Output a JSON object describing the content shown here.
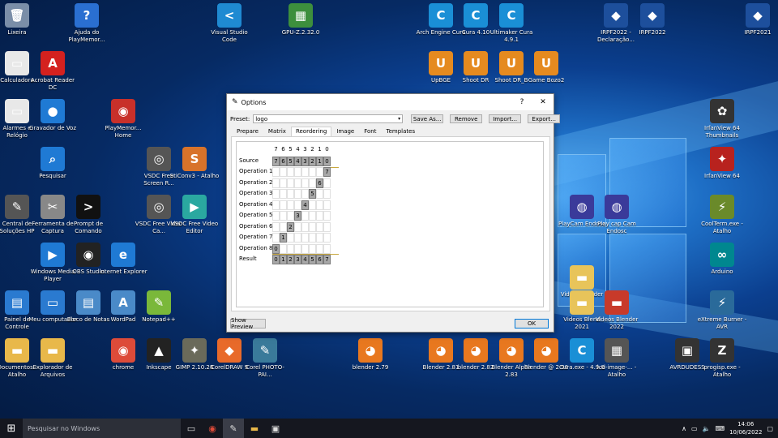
{
  "desktop_icons": [
    {
      "id": "lixeira",
      "label": "Lixeira",
      "color": "#7a8ea8",
      "glyph": "🗑"
    },
    {
      "id": "ajuda",
      "label": "Ajuda do PlayMemor...",
      "color": "#2a6fd1",
      "glyph": "?"
    },
    {
      "id": "vscode",
      "label": "Visual Studio Code",
      "color": "#1f8ad2",
      "glyph": "<"
    },
    {
      "id": "gpuz",
      "label": "GPU-Z.2.32.0",
      "color": "#3d8f3d",
      "glyph": "▦"
    },
    {
      "id": "arch",
      "label": "Arch Engine Cura",
      "color": "#1a8fd6",
      "glyph": "C"
    },
    {
      "id": "cura410",
      "label": "Cura 4.10",
      "color": "#1a8fd6",
      "glyph": "C"
    },
    {
      "id": "ultimaker",
      "label": "Ultimaker Cura 4.9.1",
      "color": "#1a8fd6",
      "glyph": "C"
    },
    {
      "id": "irpf2022d",
      "label": "IRPF2022 - Declaração...",
      "color": "#1d4f9c",
      "glyph": "◆"
    },
    {
      "id": "irpf2022",
      "label": "IRPF2022",
      "color": "#1d4f9c",
      "glyph": "◆"
    },
    {
      "id": "irpf2021",
      "label": "IRPF2021",
      "color": "#1d4f9c",
      "glyph": "◆"
    },
    {
      "id": "calculadora",
      "label": "Calculadora",
      "color": "#e8e8e8",
      "glyph": "▭"
    },
    {
      "id": "acrobat",
      "label": "Acrobat Reader DC",
      "color": "#d4211f",
      "glyph": "A"
    },
    {
      "id": "upbge",
      "label": "UpBGE",
      "color": "#e58a1f",
      "glyph": "U"
    },
    {
      "id": "shootdr",
      "label": "Shoot DR",
      "color": "#e58a1f",
      "glyph": "U"
    },
    {
      "id": "shootdrb",
      "label": "Shoot DR_B",
      "color": "#e58a1f",
      "glyph": "U"
    },
    {
      "id": "gamebozo",
      "label": "Game Bozo2",
      "color": "#e58a1f",
      "glyph": "U"
    },
    {
      "id": "alarmes",
      "label": "Alarmes e Relógio",
      "color": "#e8e8e8",
      "glyph": "▭"
    },
    {
      "id": "gravador",
      "label": "Gravador de Voz",
      "color": "#1f7ad4",
      "glyph": "●"
    },
    {
      "id": "playhome",
      "label": "PlayMemor... Home",
      "color": "#c8302a",
      "glyph": "◉"
    },
    {
      "id": "irfanthumb",
      "label": "IrfanView 64 Thumbnails",
      "color": "#333",
      "glyph": "✿"
    },
    {
      "id": "pesquisar",
      "label": "Pesquisar",
      "color": "#1f7ad4",
      "glyph": "⌕"
    },
    {
      "id": "vsdcscreen",
      "label": "VSDC Free Screen R...",
      "color": "#555",
      "glyph": "◎"
    },
    {
      "id": "stconv",
      "label": "StiConv3 - Atalho",
      "color": "#d8732a",
      "glyph": "S"
    },
    {
      "id": "irfan64",
      "label": "IrfanView 64",
      "color": "#b8221e",
      "glyph": "✦"
    },
    {
      "id": "hp",
      "label": "Central de Soluções HP",
      "color": "#555",
      "glyph": "✎"
    },
    {
      "id": "captura",
      "label": "Ferramenta de Captura",
      "color": "#888",
      "glyph": "✂"
    },
    {
      "id": "prompt",
      "label": "Prompt de Comando",
      "color": "#111",
      "glyph": ">"
    },
    {
      "id": "vsdcvideo",
      "label": "VSDC Free Video Ca...",
      "color": "#555",
      "glyph": "◎"
    },
    {
      "id": "vsdceditor",
      "label": "VSDC Free Video Editor",
      "color": "#2aa8a0",
      "glyph": "▶"
    },
    {
      "id": "playcam",
      "label": "PlayCam Endosc",
      "color": "#3a3a9a",
      "glyph": "◍"
    },
    {
      "id": "playcamh",
      "label": "Play cap Cam Endosc",
      "color": "#3a3a9a",
      "glyph": "◍"
    },
    {
      "id": "coolterm",
      "label": "CoolTerm.exe - Atalho",
      "color": "#6a8a2a",
      "glyph": "⚡"
    },
    {
      "id": "wmp",
      "label": "Windows Media Player",
      "color": "#1f7ad4",
      "glyph": "▶"
    },
    {
      "id": "obs",
      "label": "OBS Studio",
      "color": "#222",
      "glyph": "◉"
    },
    {
      "id": "ie",
      "label": "Internet Explorer",
      "color": "#1f7ad4",
      "glyph": "e"
    },
    {
      "id": "arduino",
      "label": "Arduino",
      "color": "#00878f",
      "glyph": "∞"
    },
    {
      "id": "videos",
      "label": "Videos Blender",
      "color": "#e8c45a",
      "glyph": "▬"
    },
    {
      "id": "painel",
      "label": "Painel de Controle",
      "color": "#2a7ad0",
      "glyph": "▤"
    },
    {
      "id": "meucomp",
      "label": "Meu computador",
      "color": "#2a7ad0",
      "glyph": "▭"
    },
    {
      "id": "bloco",
      "label": "Bloco de Notas",
      "color": "#4a8ac8",
      "glyph": "▤"
    },
    {
      "id": "wordpad",
      "label": "WordPad",
      "color": "#4a8ac8",
      "glyph": "A"
    },
    {
      "id": "notepadpp",
      "label": "Notepad++",
      "color": "#7ab83a",
      "glyph": "✎"
    },
    {
      "id": "videosblend",
      "label": "Videos Blend 2021",
      "color": "#e8c45a",
      "glyph": "▬"
    },
    {
      "id": "videosblend22",
      "label": "Videos Blender 2022",
      "color": "#c83a2a",
      "glyph": "▬"
    },
    {
      "id": "extreme",
      "label": "eXtreme Burner - AVR",
      "color": "#2a6a9a",
      "glyph": "⚡"
    },
    {
      "id": "documentos",
      "label": "Documentos - Atalho",
      "color": "#e8b84a",
      "glyph": "▬"
    },
    {
      "id": "explorador",
      "label": "Explorador de Arquivos",
      "color": "#e8b84a",
      "glyph": "▬"
    },
    {
      "id": "chrome",
      "label": "chrome",
      "color": "#dd4b39",
      "glyph": "◉"
    },
    {
      "id": "inkscape",
      "label": "Inkscape",
      "color": "#222",
      "glyph": "▲"
    },
    {
      "id": "gimp",
      "label": "GIMP 2.10.28",
      "color": "#6a6a5a",
      "glyph": "✦"
    },
    {
      "id": "coreldraw",
      "label": "CorelDRAW 9",
      "color": "#e86a2a",
      "glyph": "◆"
    },
    {
      "id": "corelphoto",
      "label": "Corel PHOTO-PAI...",
      "color": "#3a7a9a",
      "glyph": "✎"
    },
    {
      "id": "blender279",
      "label": "blender 2.79",
      "color": "#e8781f",
      "glyph": "◕"
    },
    {
      "id": "blender281",
      "label": "Blender 2.81",
      "color": "#e8781f",
      "glyph": "◕"
    },
    {
      "id": "blender282",
      "label": "blender 2.82",
      "color": "#e8781f",
      "glyph": "◕"
    },
    {
      "id": "blenderalpha",
      "label": "Blender Alpha 2.83",
      "color": "#e8781f",
      "glyph": "◕"
    },
    {
      "id": "blender290",
      "label": "Blender @ 2.90",
      "color": "#e8781f",
      "glyph": "◕"
    },
    {
      "id": "curaexe",
      "label": "Cura.exe - 4.9.0",
      "color": "#1a8fd6",
      "glyph": "C"
    },
    {
      "id": "lcd",
      "label": "lcd-image-... - Atalho",
      "color": "#555",
      "glyph": "▦"
    },
    {
      "id": "avrdudess",
      "label": "AVRDUDESS",
      "color": "#333",
      "glyph": "▣"
    },
    {
      "id": "progisp",
      "label": "progisp.exe - Atalho",
      "color": "#333",
      "glyph": "Z"
    }
  ],
  "dialog": {
    "title": "Options",
    "help_label": "?",
    "close_label": "✕",
    "preset_label": "Preset:",
    "preset_value": "logo",
    "buttons": {
      "save_as": "Save As...",
      "remove": "Remove",
      "import": "Import...",
      "export": "Export..."
    },
    "tabs": [
      "Prepare",
      "Matrix",
      "Reordering",
      "Image",
      "Font",
      "Templates"
    ],
    "active_tab": "Reordering",
    "grid": {
      "headers": [
        "7",
        "6",
        "5",
        "4",
        "3",
        "2",
        "1",
        "0"
      ],
      "source_label": "Source",
      "source_values": [
        "7",
        "6",
        "5",
        "4",
        "3",
        "2",
        "1",
        "0"
      ],
      "operations": [
        {
          "label": "Operation 1",
          "col": 7,
          "value": "7"
        },
        {
          "label": "Operation 2",
          "col": 6,
          "value": "6"
        },
        {
          "label": "Operation 3",
          "col": 5,
          "value": "5"
        },
        {
          "label": "Operation 4",
          "col": 4,
          "value": "4"
        },
        {
          "label": "Operation 5",
          "col": 3,
          "value": "3"
        },
        {
          "label": "Operation 6",
          "col": 2,
          "value": "2"
        },
        {
          "label": "Operation 7",
          "col": 1,
          "value": "1"
        },
        {
          "label": "Operation 8",
          "col": 0,
          "value": "0"
        }
      ],
      "result_label": "Result",
      "result_values": [
        "0",
        "1",
        "2",
        "3",
        "4",
        "5",
        "6",
        "7"
      ]
    },
    "show_preview_label": "Show Preview",
    "ok_label": "OK"
  },
  "taskbar": {
    "search_placeholder": "Pesquisar no Windows",
    "time": "14:06",
    "date": "10/06/2022"
  }
}
